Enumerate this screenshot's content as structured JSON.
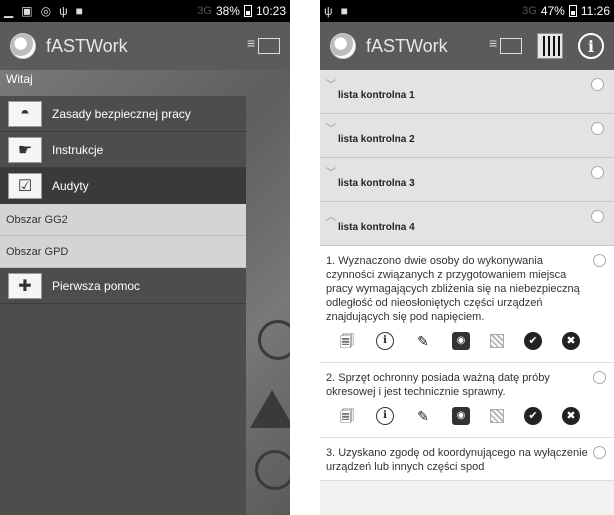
{
  "left_phone": {
    "status": {
      "net": "3G",
      "battery": "38%",
      "time": "10:23"
    },
    "app_title": "fASTWork",
    "greeting": "Witaj",
    "menu": [
      {
        "label": "Zasady bezpiecznej pracy",
        "icon": "helmet-icon"
      },
      {
        "label": "Instrukcje",
        "icon": "instructions-icon"
      },
      {
        "label": "Audyty",
        "icon": "checklist-icon"
      }
    ],
    "sub_items": [
      "Obszar GG2",
      "Obszar GPD"
    ],
    "first_aid": {
      "label": "Pierwsza pomoc",
      "icon": "first-aid-icon"
    }
  },
  "right_phone": {
    "status": {
      "net": "3G",
      "battery": "47%",
      "time": "11:26"
    },
    "app_title": "fASTWork",
    "checklists": [
      "lista kontrolna 1",
      "lista kontrolna 2",
      "lista kontrolna 3",
      "lista kontrolna 4"
    ],
    "questions": [
      "1. Wyznaczono dwie osoby do wykonywania czynności związanych z przygotowaniem miejsca pracy wymagających zbliżenia się na niebezpieczną odległość od nieosłoniętych części urządzeń znajdujących się pod napięciem.",
      "2. Sprzęt ochronny posiada ważną datę próby okresowej i jest technicznie sprawny.",
      "3. Uzyskano zgodę od koordynującego na wyłączenie urządzeń lub innych części spod"
    ],
    "action_icons": [
      "document-icon",
      "info-icon",
      "pen-icon",
      "camera-icon",
      "qr-icon",
      "check-icon",
      "cancel-icon"
    ]
  }
}
